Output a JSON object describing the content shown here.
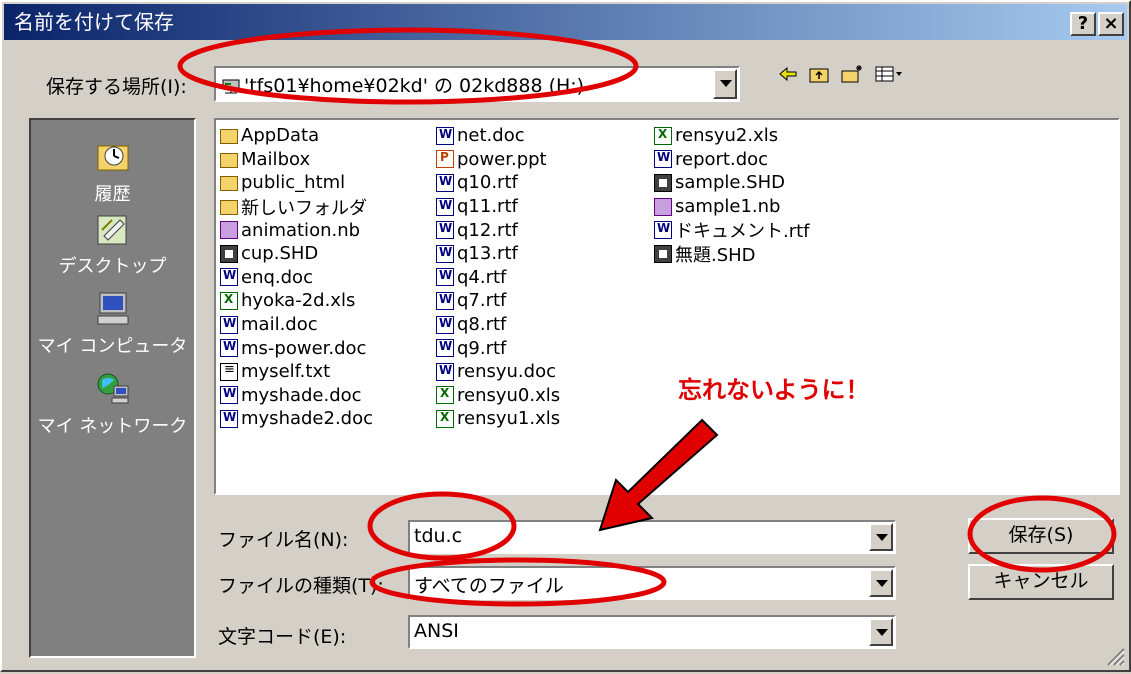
{
  "window": {
    "title": "名前を付けて保存",
    "help_label": "?",
    "close_label": "×"
  },
  "location": {
    "label": "保存する場所(I):",
    "value": "'tfs01¥home¥02kd' の 02kd888 (H:)"
  },
  "places": [
    {
      "label": "履歴",
      "icon": "history-icon"
    },
    {
      "label": "デスクトップ",
      "icon": "desktop-icon"
    },
    {
      "label": "マイ コンピュータ",
      "icon": "my-computer-icon"
    },
    {
      "label": "マイ ネットワーク",
      "icon": "my-network-icon"
    }
  ],
  "files": {
    "col1": [
      {
        "name": "AppData",
        "icon": "folder"
      },
      {
        "name": "Mailbox",
        "icon": "folder"
      },
      {
        "name": "public_html",
        "icon": "folder"
      },
      {
        "name": "新しいフォルダ",
        "icon": "folder"
      },
      {
        "name": "animation.nb",
        "icon": "nb"
      },
      {
        "name": "cup.SHD",
        "icon": "shd"
      },
      {
        "name": "enq.doc",
        "icon": "word"
      },
      {
        "name": "hyoka-2d.xls",
        "icon": "excel"
      },
      {
        "name": "mail.doc",
        "icon": "word"
      },
      {
        "name": "ms-power.doc",
        "icon": "word"
      },
      {
        "name": "myself.txt",
        "icon": "txt"
      },
      {
        "name": "myshade.doc",
        "icon": "word"
      },
      {
        "name": "myshade2.doc",
        "icon": "word"
      }
    ],
    "col2": [
      {
        "name": "net.doc",
        "icon": "word"
      },
      {
        "name": "power.ppt",
        "icon": "ppt"
      },
      {
        "name": "q10.rtf",
        "icon": "word"
      },
      {
        "name": "q11.rtf",
        "icon": "word"
      },
      {
        "name": "q12.rtf",
        "icon": "word"
      },
      {
        "name": "q13.rtf",
        "icon": "word"
      },
      {
        "name": "q4.rtf",
        "icon": "word"
      },
      {
        "name": "q7.rtf",
        "icon": "word"
      },
      {
        "name": "q8.rtf",
        "icon": "word"
      },
      {
        "name": "q9.rtf",
        "icon": "word"
      },
      {
        "name": "rensyu.doc",
        "icon": "word"
      },
      {
        "name": "rensyu0.xls",
        "icon": "excel"
      },
      {
        "name": "rensyu1.xls",
        "icon": "excel"
      }
    ],
    "col3": [
      {
        "name": "rensyu2.xls",
        "icon": "excel"
      },
      {
        "name": "report.doc",
        "icon": "word"
      },
      {
        "name": "sample.SHD",
        "icon": "shd"
      },
      {
        "name": "sample1.nb",
        "icon": "nb"
      },
      {
        "name": "ドキュメント.rtf",
        "icon": "word"
      },
      {
        "name": "無題.SHD",
        "icon": "shd"
      }
    ]
  },
  "form": {
    "filename_label": "ファイル名(N):",
    "filename_value": "tdu.c",
    "filetype_label": "ファイルの種類(T):",
    "filetype_value": "すべてのファイル",
    "encoding_label": "文字コード(E):",
    "encoding_value": "ANSI"
  },
  "buttons": {
    "save": "保存(S)",
    "cancel": "キャンセル"
  },
  "annotation": {
    "note": "忘れないように！",
    "color": "#e00000"
  }
}
